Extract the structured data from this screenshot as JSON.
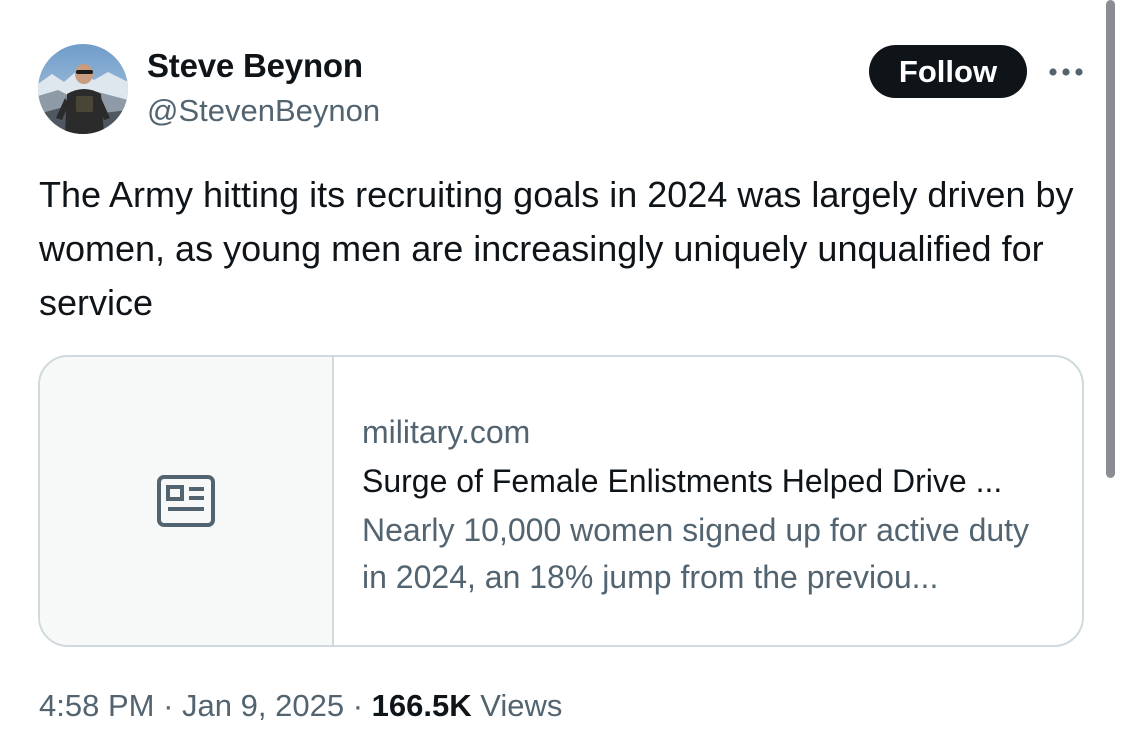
{
  "author": {
    "display_name": "Steve Beynon",
    "handle": "@StevenBeynon",
    "avatar_icon": "profile-photo"
  },
  "actions": {
    "follow_label": "Follow",
    "more_icon": "more-horizontal-icon"
  },
  "tweet": {
    "text": "The Army hitting its recruiting goals in 2024 was largely driven by women, as young men are increasingly uniquely unqualified for service"
  },
  "link_card": {
    "icon": "newspaper-icon",
    "domain": "military.com",
    "title": "Surge of Female Enlistments Helped Drive ...",
    "description": "Nearly 10,000 women signed up for active duty in 2024, an 18% jump from the previou..."
  },
  "meta": {
    "time": "4:58 PM",
    "separator": "·",
    "date": "Jan 9, 2025",
    "views_count": "166.5K",
    "views_label": "Views"
  },
  "colors": {
    "text_primary": "#0f1419",
    "text_secondary": "#536471",
    "border": "#cfd9de",
    "button_bg": "#0f1419"
  }
}
